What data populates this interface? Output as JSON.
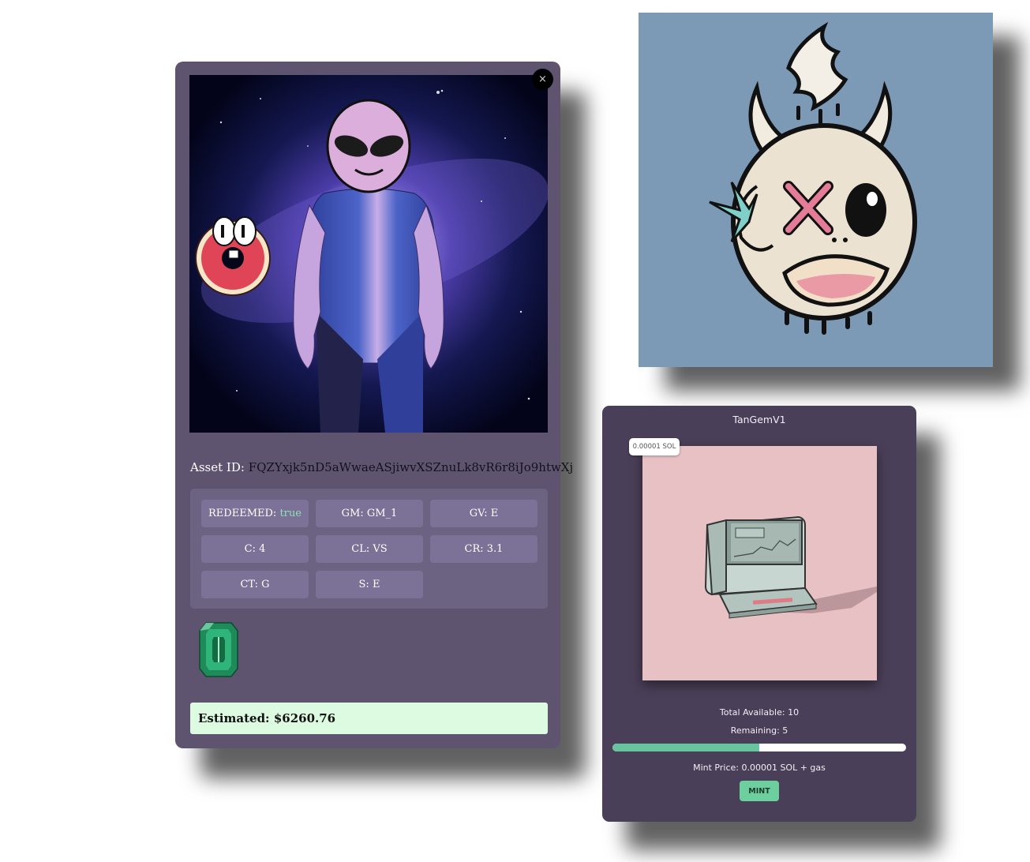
{
  "asset_card": {
    "close_label": "×",
    "asset_id_label": "Asset ID:",
    "asset_id_value": "FQZYxjk5nD5aWwaeASjiwvXSZnuLk8vR6r8iJo9htwXj",
    "attributes": [
      {
        "key": "REDEEMED:",
        "value": "true"
      },
      {
        "text": "GM: GM_1"
      },
      {
        "text": "GV: E"
      },
      {
        "text": "C: 4"
      },
      {
        "text": "CL: VS"
      },
      {
        "text": "CR: 3.1"
      },
      {
        "text": "CT: G"
      },
      {
        "text": "S: E"
      }
    ],
    "estimated_label": "Estimated: $6260.76",
    "gem_icon": "emerald-gem-icon"
  },
  "mint_card": {
    "title": "TanGemV1",
    "price_badge": "0.00001 SOL",
    "total_available": "Total Available: 10",
    "remaining": "Remaining: 5",
    "progress_fraction": 0.5,
    "mint_price": "Mint Price: 0.00001 SOL + gas",
    "mint_button": "MINT"
  },
  "colors": {
    "card_bg": "#5e5470",
    "attribute_chip": "#7c7197",
    "estimated_bg": "#dcfbe0",
    "mint_card_bg": "#4a3f58",
    "accent_green": "#67c49d",
    "devil_bg": "#7c9ab5",
    "computer_bg": "#e7c1c4"
  }
}
